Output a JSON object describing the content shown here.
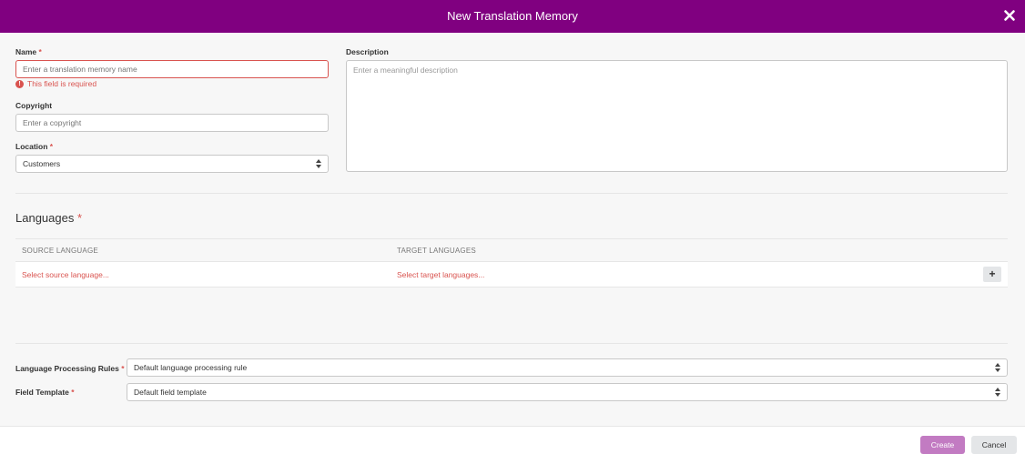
{
  "dialog": {
    "title": "New Translation Memory"
  },
  "required_mark": "*",
  "name": {
    "label": "Name",
    "placeholder": "Enter a translation memory name",
    "error": "This field is required",
    "error_icon": "exclamation-circle-icon"
  },
  "copyright": {
    "label": "Copyright",
    "placeholder": "Enter a copyright"
  },
  "location": {
    "label": "Location",
    "value": "Customers"
  },
  "description": {
    "label": "Description",
    "placeholder": "Enter a meaningful description"
  },
  "languages": {
    "title": "Languages",
    "source_header": "SOURCE LANGUAGE",
    "target_header": "TARGET LANGUAGES",
    "source_prompt": "Select source language...",
    "target_prompt": "Select target languages...",
    "add_label": "+"
  },
  "processing_rules": {
    "label": "Language Processing Rules",
    "value": "Default language processing rule"
  },
  "field_template": {
    "label": "Field Template",
    "value": "Default field template"
  },
  "footer": {
    "create_label": "Create",
    "cancel_label": "Cancel"
  },
  "colors": {
    "header": "#800080",
    "error": "#d9534f",
    "create_button": "#c27bc2"
  }
}
